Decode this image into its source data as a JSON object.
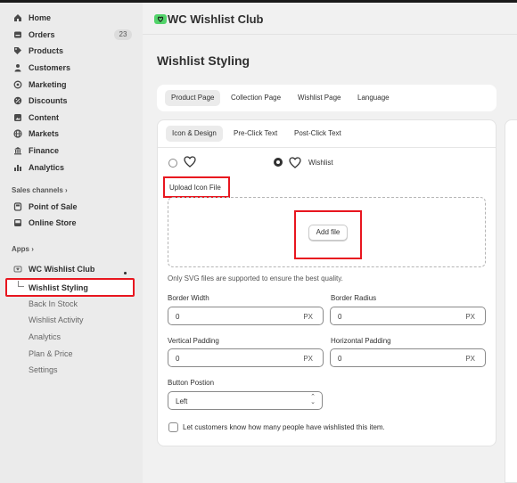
{
  "sidebar": {
    "nav": [
      {
        "label": "Home",
        "icon": "home-icon"
      },
      {
        "label": "Orders",
        "icon": "orders-icon",
        "badge": "23"
      },
      {
        "label": "Products",
        "icon": "tag-icon"
      },
      {
        "label": "Customers",
        "icon": "person-icon"
      },
      {
        "label": "Marketing",
        "icon": "target-icon"
      },
      {
        "label": "Discounts",
        "icon": "discount-icon"
      },
      {
        "label": "Content",
        "icon": "content-icon"
      },
      {
        "label": "Markets",
        "icon": "globe-icon"
      },
      {
        "label": "Finance",
        "icon": "bank-icon"
      },
      {
        "label": "Analytics",
        "icon": "bar-chart-icon"
      }
    ],
    "sales_channels_heading": "Sales channels",
    "sales_channels": [
      {
        "label": "Point of Sale",
        "icon": "pos-icon"
      },
      {
        "label": "Online Store",
        "icon": "store-icon"
      }
    ],
    "apps_heading": "Apps",
    "app_name": "WC Wishlist Club",
    "app_subitems": [
      "Wishlist Styling",
      "Back In Stock",
      "Wishlist Activity",
      "Analytics",
      "Plan & Price",
      "Settings"
    ]
  },
  "header": {
    "app_title": "WC Wishlist Club"
  },
  "page": {
    "title": "Wishlist Styling",
    "tabs": [
      "Product Page",
      "Collection Page",
      "Wishlist Page",
      "Language"
    ],
    "subtabs": [
      "Icon & Design",
      "Pre-Click Text",
      "Post-Click Text"
    ],
    "option_label": "Wishlist",
    "upload_label": "Upload Icon File",
    "add_file": "Add file",
    "hint": "Only SVG files are supported to ensure the best quality.",
    "fields": {
      "border_width": {
        "label": "Border Width",
        "value": "0",
        "unit": "PX"
      },
      "border_radius": {
        "label": "Border Radius",
        "value": "0",
        "unit": "PX"
      },
      "vertical_padding": {
        "label": "Vertical Padding",
        "value": "0",
        "unit": "PX"
      },
      "horizontal_padding": {
        "label": "Horizontal Padding",
        "value": "0",
        "unit": "PX"
      }
    },
    "button_position": {
      "label": "Button Postion",
      "value": "Left"
    },
    "checkbox_label": "Let customers know how many people have wishlisted this item."
  },
  "colors": {
    "highlight": "#e8161f",
    "app_logo": "#52d36a"
  }
}
